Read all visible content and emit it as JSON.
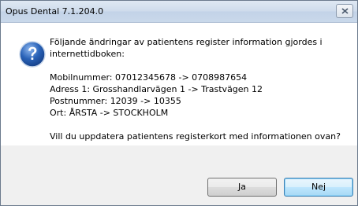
{
  "window": {
    "title": "Opus Dental 7.1.204.0"
  },
  "message": {
    "intro": "Följande ändringar av patientens register information gjordes i internettidboken:",
    "changes": [
      "Mobilnummer: 07012345678 -> 0708987654",
      "Adress 1: Grosshandlarvägen 1 -> Trastvägen 12",
      "Postnummer: 12039 -> 10355",
      "Ort: ÅRSTA -> STOCKHOLM"
    ],
    "question": "Vill du uppdatera patientens registerkort med informationen ovan?"
  },
  "buttons": {
    "yes_label": "Ja",
    "no_label": "Nej"
  },
  "icons": {
    "dialog_icon": "question-icon",
    "close_icon": "close-icon"
  },
  "colors": {
    "question_icon": "#2a63b8",
    "close_glyph": "#4b5a6e"
  }
}
